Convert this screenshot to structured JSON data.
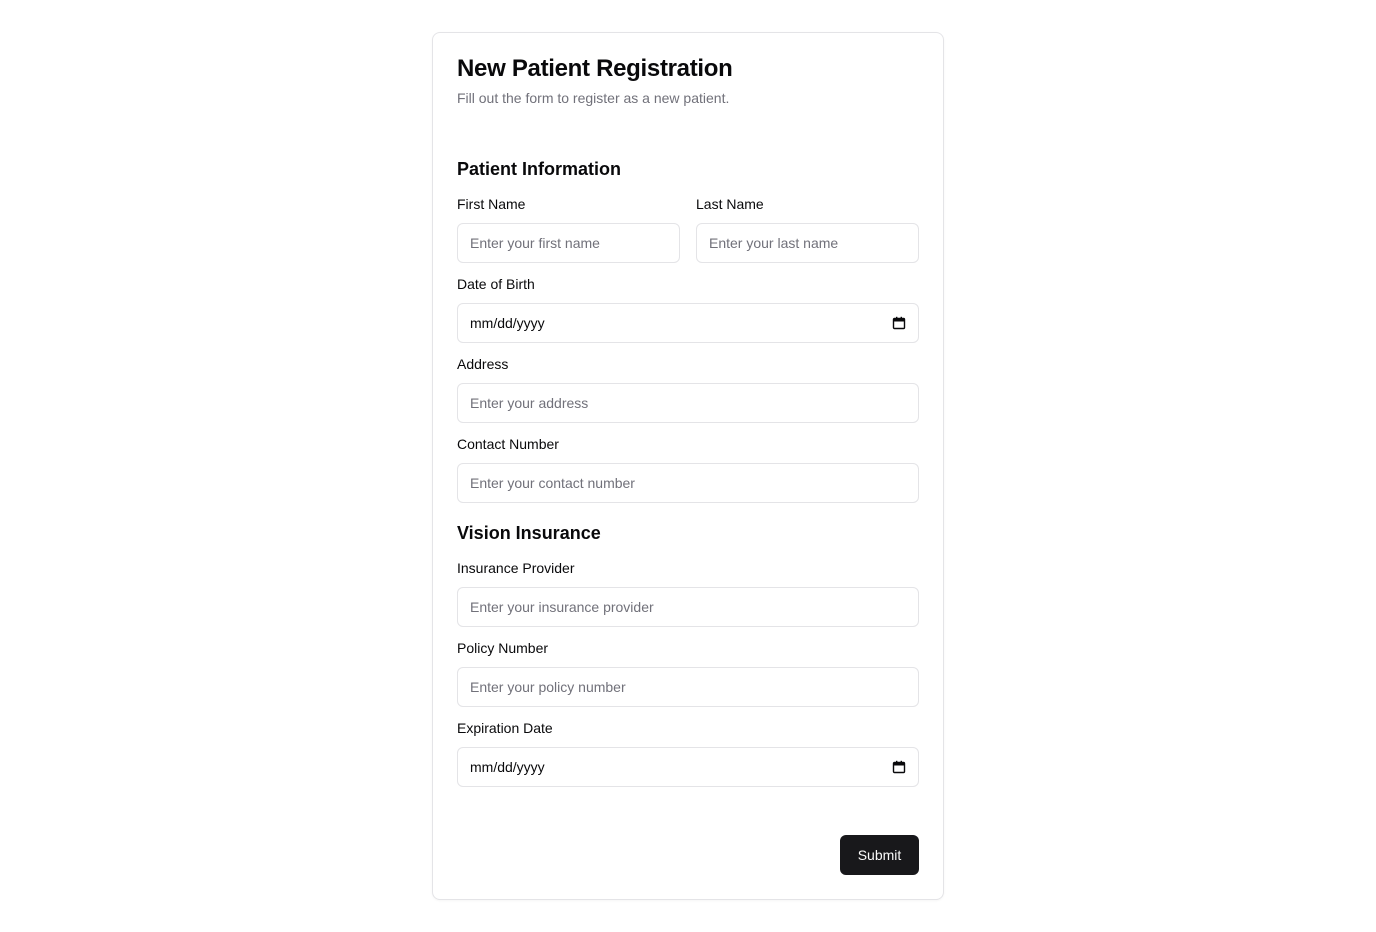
{
  "form": {
    "title": "New Patient Registration",
    "subtitle": "Fill out the form to register as a new patient.",
    "submit_label": "Submit"
  },
  "patient_info": {
    "heading": "Patient Information",
    "first_name": {
      "label": "First Name",
      "placeholder": "Enter your first name",
      "value": ""
    },
    "last_name": {
      "label": "Last Name",
      "placeholder": "Enter your last name",
      "value": ""
    },
    "dob": {
      "label": "Date of Birth",
      "display": "mm/dd/yyyy"
    },
    "address": {
      "label": "Address",
      "placeholder": "Enter your address",
      "value": ""
    },
    "contact": {
      "label": "Contact Number",
      "placeholder": "Enter your contact number",
      "value": ""
    }
  },
  "insurance": {
    "heading": "Vision Insurance",
    "provider": {
      "label": "Insurance Provider",
      "placeholder": "Enter your insurance provider",
      "value": ""
    },
    "policy": {
      "label": "Policy Number",
      "placeholder": "Enter your policy number",
      "value": ""
    },
    "expiration": {
      "label": "Expiration Date",
      "display": "mm/dd/yyyy"
    }
  },
  "icons": {
    "date_picker": "calendar-icon"
  },
  "colors": {
    "primary_button": "#18181b",
    "border": "#e4e4e7",
    "muted_text": "#71717a"
  }
}
